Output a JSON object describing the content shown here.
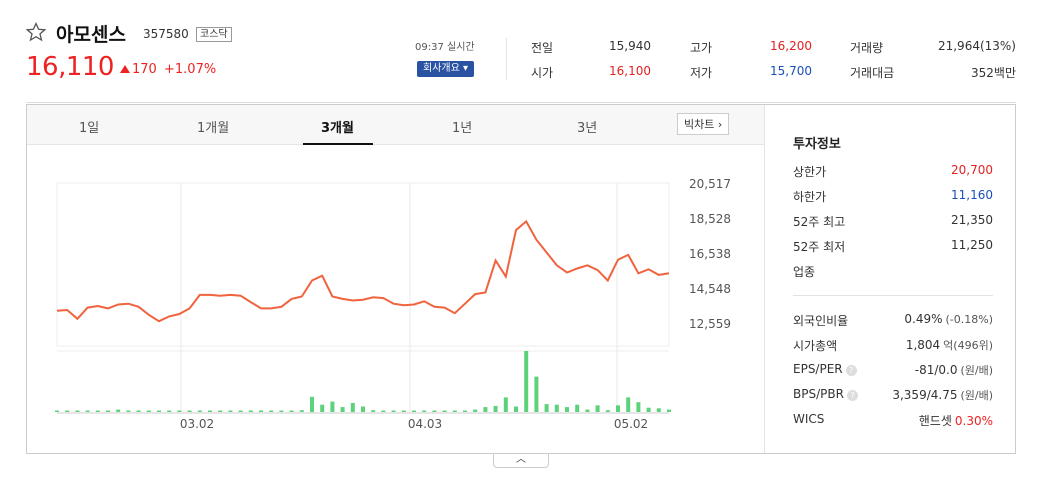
{
  "stock": {
    "name": "아모센스",
    "code": "357580",
    "market": "코스닥",
    "price": "16,110",
    "change": "170",
    "change_pct": "+1.07%"
  },
  "header": {
    "time_label": "09:37 실시간",
    "company_btn": "회사개요"
  },
  "stats": [
    {
      "label": "전일",
      "value": "15,940",
      "color": "#333333"
    },
    {
      "label": "고가",
      "value": "16,200",
      "color": "#e22222"
    },
    {
      "label": "거래량",
      "value": "21,964(13%)",
      "color": "#333333"
    },
    {
      "label": "시가",
      "value": "16,100",
      "color": "#e22222"
    },
    {
      "label": "저가",
      "value": "15,700",
      "color": "#1a4fba"
    },
    {
      "label": "거래대금",
      "value": "352백만",
      "color": "#333333"
    }
  ],
  "tabs": [
    "1일",
    "1개월",
    "3개월",
    "1년",
    "3년"
  ],
  "active_tab": "3개월",
  "big_chart_btn": "빅차트",
  "chart_data": {
    "type": "line",
    "y_ticks": [
      "20,517",
      "18,528",
      "16,538",
      "14,548",
      "12,559"
    ],
    "x_ticks": [
      "03.02",
      "04.03",
      "05.02"
    ],
    "ylim": [
      11200,
      21400
    ],
    "price_series": [
      13400,
      13450,
      12900,
      13600,
      13700,
      13550,
      13800,
      13850,
      13650,
      13150,
      12750,
      13050,
      13200,
      13550,
      14400,
      14400,
      14350,
      14400,
      14350,
      13950,
      13550,
      13550,
      13650,
      14150,
      14300,
      15300,
      15600,
      14300,
      14150,
      14050,
      14100,
      14250,
      14200,
      13850,
      13750,
      13800,
      14000,
      13650,
      13600,
      13250,
      13850,
      14450,
      14550,
      16550,
      15550,
      18450,
      19000,
      17850,
      17050,
      16250,
      15800,
      16050,
      16250,
      15950,
      15300,
      16600,
      16900,
      15750,
      16000,
      15650,
      15750
    ],
    "volume_series": [
      1,
      1,
      1,
      1,
      1,
      1,
      4,
      2,
      1,
      1,
      1,
      1,
      1,
      1,
      2,
      2,
      1,
      1,
      1,
      1,
      1,
      1,
      1,
      1,
      3,
      25,
      12,
      17,
      8,
      15,
      9,
      3,
      2,
      2,
      2,
      2,
      1,
      2,
      2,
      2,
      2,
      4,
      8,
      10,
      24,
      9,
      100,
      58,
      13,
      12,
      8,
      12,
      4,
      11,
      3,
      11,
      24,
      16,
      7,
      6,
      4
    ]
  },
  "investment": {
    "title": "투자정보",
    "rows": [
      {
        "label": "상한가",
        "value": "20,700",
        "color": "#e22222"
      },
      {
        "label": "하한가",
        "value": "11,160",
        "color": "#1a4fba"
      },
      {
        "label": "52주 최고",
        "value": "21,350",
        "color": "#333333"
      },
      {
        "label": "52주 최저",
        "value": "11,250",
        "color": "#333333"
      },
      {
        "label": "업종",
        "value": "",
        "color": "#333333"
      }
    ],
    "rows2": [
      {
        "label": "외국인비율",
        "value": "0.49%",
        "sub": "(-0.18%)"
      },
      {
        "label": "시가총액",
        "value": "1,804",
        "sub": "억(496위)"
      },
      {
        "label": "EPS/PER",
        "value": "-81/0.0",
        "sub": "(원/배)",
        "help": "?"
      },
      {
        "label": "BPS/PBR",
        "value": "3,359/4.75",
        "sub": "(원/배)",
        "help": "?"
      },
      {
        "label": "WICS",
        "value": "핸드셋",
        "sub": "0.30%"
      }
    ]
  }
}
